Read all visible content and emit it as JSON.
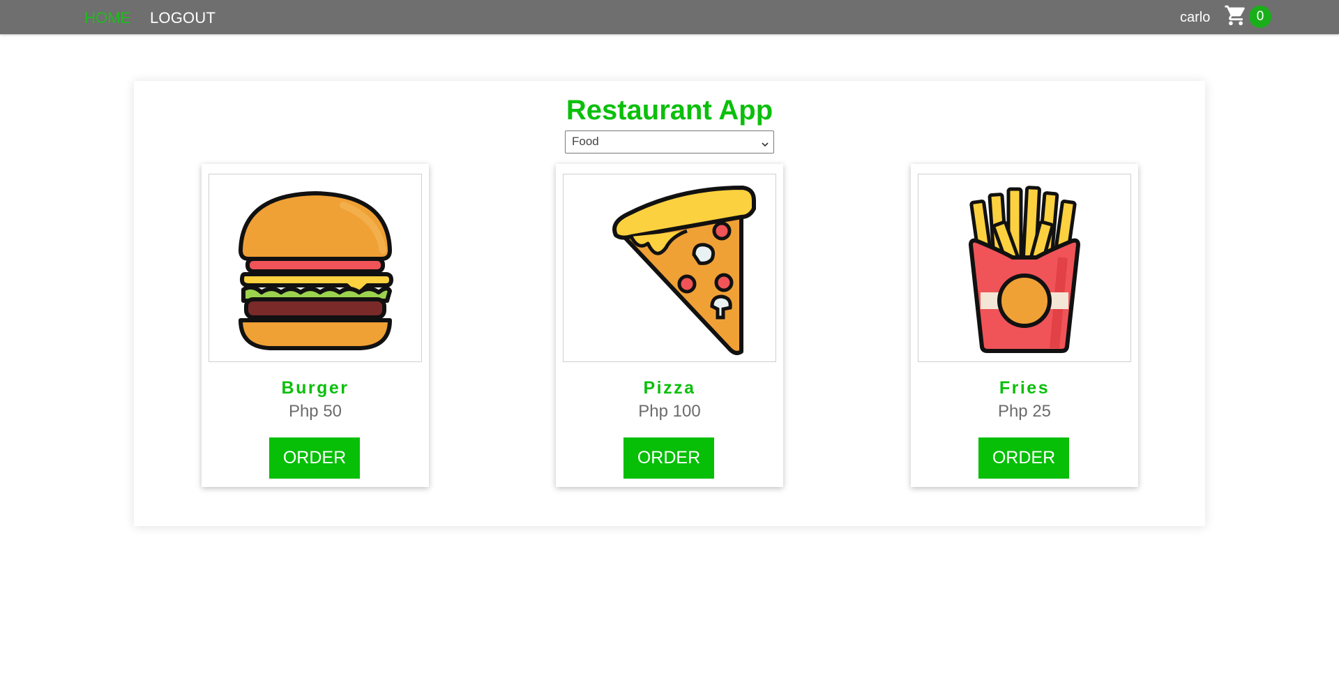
{
  "nav": {
    "home_label": "HOME",
    "logout_label": "LOGOUT",
    "username": "carlo",
    "cart_icon": "shopping-cart-icon",
    "cart_count": "0"
  },
  "main": {
    "title": "Restaurant App",
    "category_select": {
      "selected": "Food"
    }
  },
  "items": [
    {
      "name": "Burger",
      "price": "Php 50",
      "button_label": "ORDER",
      "image": "burger-image"
    },
    {
      "name": "Pizza",
      "price": "Php 100",
      "button_label": "ORDER",
      "image": "pizza-image"
    },
    {
      "name": "Fries",
      "price": "Php 25",
      "button_label": "ORDER",
      "image": "fries-image"
    }
  ],
  "colors": {
    "accent_green": "#0bbf0b",
    "nav_bg": "#6f6f6f",
    "price_gray": "#6b6b6b"
  }
}
